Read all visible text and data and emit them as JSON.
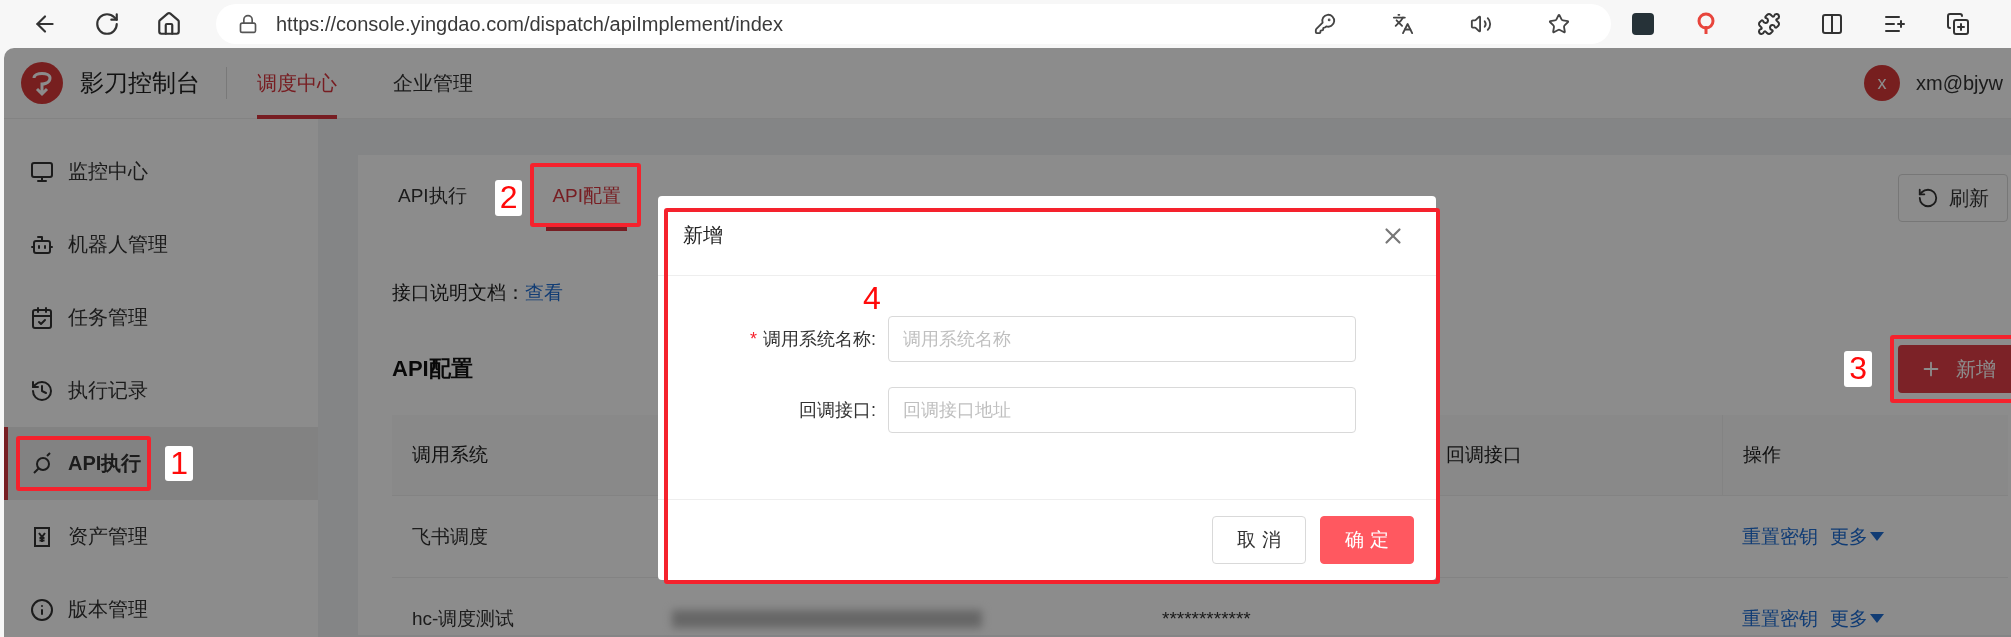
{
  "browser": {
    "url": "https://console.yingdao.com/dispatch/apiImplement/index"
  },
  "header": {
    "app_title": "影刀控制台",
    "nav": [
      {
        "label": "调度中心",
        "selected": true
      },
      {
        "label": "企业管理",
        "selected": false
      }
    ],
    "user": {
      "avatar": "x",
      "email": "xm@bjyw"
    }
  },
  "sidebar": {
    "items": [
      {
        "label": "监控中心",
        "selected": false
      },
      {
        "label": "机器人管理",
        "selected": false
      },
      {
        "label": "任务管理",
        "selected": false
      },
      {
        "label": "执行记录",
        "selected": false
      },
      {
        "label": "API执行",
        "selected": true,
        "annotation": "1"
      },
      {
        "label": "资产管理",
        "selected": false
      },
      {
        "label": "版本管理",
        "selected": false
      }
    ]
  },
  "page": {
    "tabs": [
      {
        "label": "API执行",
        "selected": false
      },
      {
        "label": "API配置",
        "selected": true,
        "annotation": "2"
      }
    ],
    "refresh_button": "刷新",
    "doc": {
      "label": "接口说明文档：",
      "link": "查看"
    },
    "section_title": "API配置",
    "add_button": {
      "label": "新增",
      "annotation": "3"
    },
    "table": {
      "columns": [
        "调用系统",
        "回调接口",
        "操作"
      ],
      "rows": [
        {
          "system": "飞书调度",
          "actions": [
            "重置密钥",
            "更多"
          ]
        },
        {
          "system": "hc-调度测试",
          "redacted": true,
          "column_3": "************",
          "actions": [
            "重置密钥",
            "更多"
          ]
        }
      ]
    }
  },
  "dialog": {
    "title": "新增",
    "annotation": "4",
    "fields": [
      {
        "label": "调用系统名称:",
        "required_mark": "*",
        "placeholder": "调用系统名称"
      },
      {
        "label": "回调接口:",
        "placeholder": "回调接口地址"
      }
    ],
    "buttons": [
      {
        "label": "取 消",
        "kind": "default"
      },
      {
        "label": "确 定",
        "kind": "primary"
      }
    ]
  }
}
